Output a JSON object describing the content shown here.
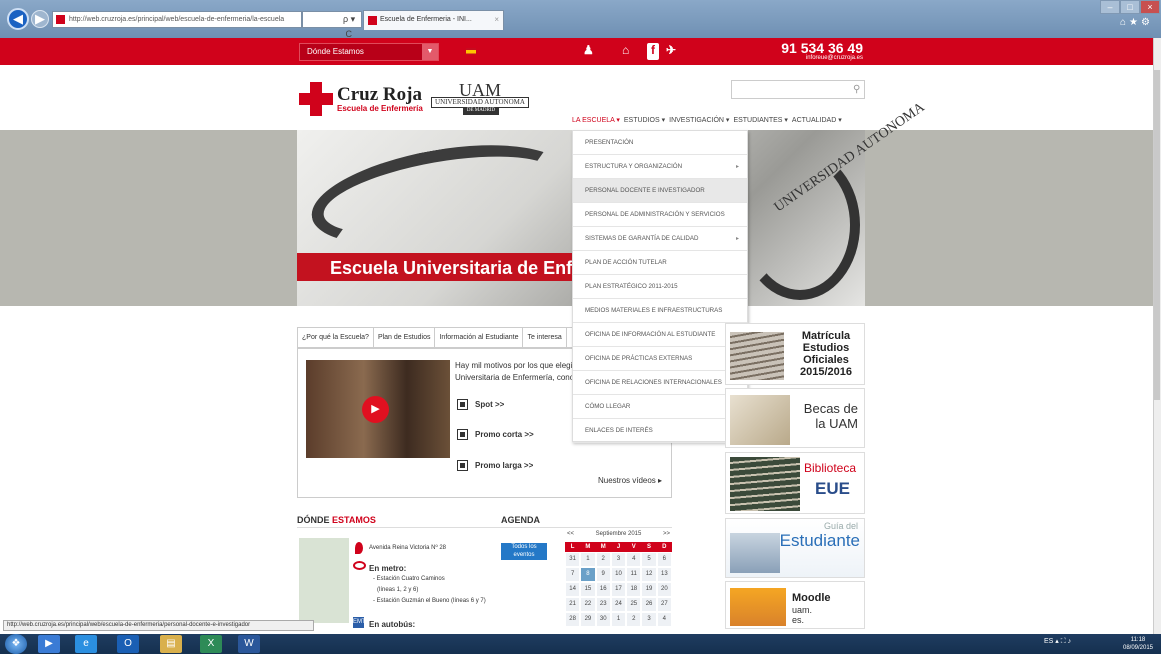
{
  "browser": {
    "address": "http://web.cruzroja.es/principal/web/escuela-de-enfermeria/la-escuela",
    "address_tools": "ρ ▾  C",
    "tab_title": "Escuela de Enfermeria - INI...",
    "tab_close": "×",
    "status_url": "http://web.cruzroja.es/principal/web/escuela-de-enfermeria/personal-docente-e-investigador",
    "window_buttons": [
      "–",
      "□",
      "×"
    ],
    "ie_icons": "⌂★⚙"
  },
  "topbar": {
    "donde": "Dónde Estamos",
    "phone": "91 534 36 49",
    "email": "inforeue@cruzroja.es",
    "social": [
      "♟",
      "⌂",
      "f",
      "✈"
    ]
  },
  "header": {
    "logo_title": "Cruz Roja",
    "logo_sub": "Escuela de Enfermería",
    "uam_mark": "UAΜ",
    "uam_text": "UNIVERSIDAD AUTONOMA",
    "uam_text2": "DE MADRID",
    "search_placeholder": ""
  },
  "nav": [
    {
      "label": "LA ESCUELA ▾",
      "active": true
    },
    {
      "label": "ESTUDIOS ▾",
      "active": false
    },
    {
      "label": "INVESTIGACIÓN ▾",
      "active": false
    },
    {
      "label": "ESTUDIANTES ▾",
      "active": false
    },
    {
      "label": "ACTUALIDAD ▾",
      "active": false
    }
  ],
  "hero": {
    "title": "Escuela Universitaria de Enfer",
    "overlay": "UNIVERSIDAD AUTONOMA"
  },
  "dropdown": [
    {
      "label": "PRESENTACIÓN",
      "arrow": false,
      "hl": false
    },
    {
      "label": "ESTRUCTURA Y ORGANIZACIÓN",
      "arrow": true,
      "hl": false
    },
    {
      "label": "PERSONAL DOCENTE E INVESTIGADOR",
      "arrow": false,
      "hl": true
    },
    {
      "label": "PERSONAL DE ADMINISTRACIÓN Y SERVICIOS",
      "arrow": false,
      "hl": false
    },
    {
      "label": "SISTEMAS DE GARANTÍA DE CALIDAD",
      "arrow": true,
      "hl": false
    },
    {
      "label": "PLAN DE ACCIÓN TUTELAR",
      "arrow": false,
      "hl": false
    },
    {
      "label": "PLAN ESTRATÉGICO 2011-2015",
      "arrow": false,
      "hl": false
    },
    {
      "label": "MEDIOS MATERIALES E INFRAESTRUCTURAS",
      "arrow": false,
      "hl": false
    },
    {
      "label": "OFICINA DE INFORMACIÓN AL ESTUDIANTE",
      "arrow": false,
      "hl": false
    },
    {
      "label": "OFICINA DE PRÁCTICAS EXTERNAS",
      "arrow": false,
      "hl": false
    },
    {
      "label": "OFICINA DE RELACIONES INTERNACIONALES",
      "arrow": true,
      "hl": false
    },
    {
      "label": "CÓMO LLEGAR",
      "arrow": false,
      "hl": false
    },
    {
      "label": "ENLACES DE INTERÉS",
      "arrow": false,
      "hl": false
    }
  ],
  "content_tabs": [
    "¿Por qué la Escuela?",
    "Plan de Estudios",
    "Información al Estudiante",
    "Te interesa"
  ],
  "intro": [
    "Hay mil motivos por los que elegir",
    "Universitaria de Enfermería, cono"
  ],
  "video_links": [
    "Spot >>",
    "Promo corta >>",
    "Promo larga >>"
  ],
  "nuestros": "Nuestros vídeos ▸",
  "donde": {
    "heading_a": "DÓNDE ",
    "heading_b": "ESTAMOS",
    "address": "Avenida Reina Victoria Nº 28",
    "metro": "En metro:",
    "metro_lines": [
      "- Estación Cuatro Caminos",
      "(líneas 1, 2 y 6)",
      "- Estación Guzmán el Bueno (líneas 6 y 7)"
    ],
    "bus": "En autobús:",
    "bus_icon": "EMT"
  },
  "agenda": {
    "heading": "AGENDA",
    "todos": "Todos los eventos",
    "prev": "<<",
    "month": "Septiembre 2015",
    "next": ">>",
    "days": [
      "L",
      "M",
      "M",
      "J",
      "V",
      "S",
      "D"
    ],
    "weeks": [
      [
        "31",
        "1",
        "2",
        "3",
        "4",
        "5",
        "6"
      ],
      [
        "7",
        "8",
        "9",
        "10",
        "11",
        "12",
        "13"
      ],
      [
        "14",
        "15",
        "16",
        "17",
        "18",
        "19",
        "20"
      ],
      [
        "21",
        "22",
        "23",
        "24",
        "25",
        "26",
        "27"
      ],
      [
        "28",
        "29",
        "30",
        "1",
        "2",
        "3",
        "4"
      ]
    ],
    "today": "8"
  },
  "side": {
    "matricula": "Matrícula Estudios Oficiales 2015/2016",
    "becas": "Becas de la UAM",
    "biblioteca": "Biblioteca",
    "eue": "EUE",
    "guia_small": "Guía del",
    "guia": "Estudiante",
    "moodle": "Moodle",
    "moodle_sub": "uam. es."
  },
  "taskbar": {
    "tray": "ES ▴ ⛶ ♪",
    "time": "11:18",
    "date": "08/09/2015",
    "apps": [
      "▶",
      "e",
      "O",
      "▤",
      "X",
      "W"
    ]
  }
}
